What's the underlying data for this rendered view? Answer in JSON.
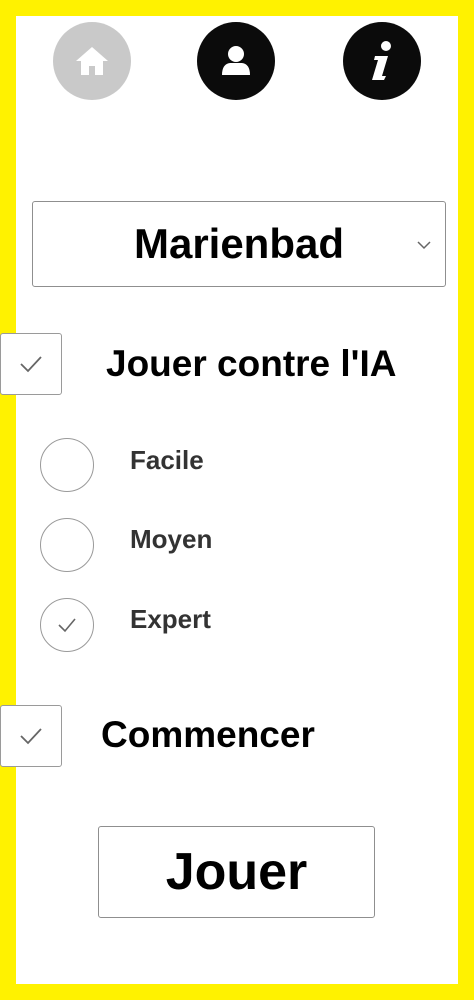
{
  "theme": {
    "frame_color": "#fff200",
    "inactive_icon_color": "#c9c9c9",
    "active_icon_color": "#0b0b0b"
  },
  "nav": {
    "home_icon": "home-icon",
    "profile_icon": "user-icon",
    "info_icon": "info-icon"
  },
  "game_select": {
    "value": "Marienbad"
  },
  "ai_toggle": {
    "label": "Jouer contre l'IA",
    "checked": true
  },
  "difficulty": {
    "options": [
      {
        "label": "Facile",
        "selected": false
      },
      {
        "label": "Moyen",
        "selected": false
      },
      {
        "label": "Expert",
        "selected": true
      }
    ]
  },
  "start_toggle": {
    "label": "Commencer",
    "checked": true
  },
  "play_button": {
    "label": "Jouer"
  }
}
